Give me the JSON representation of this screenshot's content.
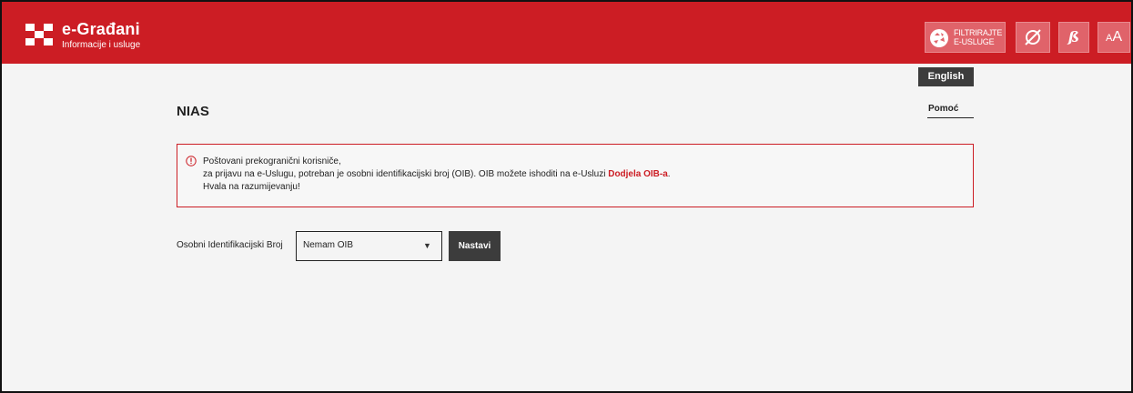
{
  "header": {
    "brand_title": "e-Građani",
    "brand_subtitle": "Informacije i usluge",
    "filter_label_line1": "FILTRIRAJTE",
    "filter_label_line2": "E-USLUGE",
    "fontsize_label_small": "A",
    "fontsize_label_large": "A",
    "dyslexic_label": "ß"
  },
  "language": {
    "label": "English"
  },
  "page": {
    "title": "NIAS",
    "help_label": "Pomoć"
  },
  "notice": {
    "line1": "Poštovani prekogranični korisniče,",
    "line2_prefix": "za prijavu na e-Uslugu, potreban je osobni identifikacijski broj (OIB). OIB možete ishoditi na e-Usluzi ",
    "line2_link": "Dodjela OIB-a",
    "line2_suffix": ".",
    "line3": "Hvala na razumijevanju!"
  },
  "form": {
    "oib_label": "Osobni Identifikacijski Broj",
    "oib_selected": "Nemam OIB",
    "continue_label": "Nastavi"
  },
  "colors": {
    "brand_red": "#cc1d24",
    "dark_button": "#3c3c3c",
    "background": "#f4f4f4"
  },
  "icons": [
    "logo-icon",
    "filter-icon",
    "contrast-icon",
    "dyslexic-font-icon",
    "font-size-icon",
    "info-icon",
    "dropdown-caret-icon"
  ]
}
